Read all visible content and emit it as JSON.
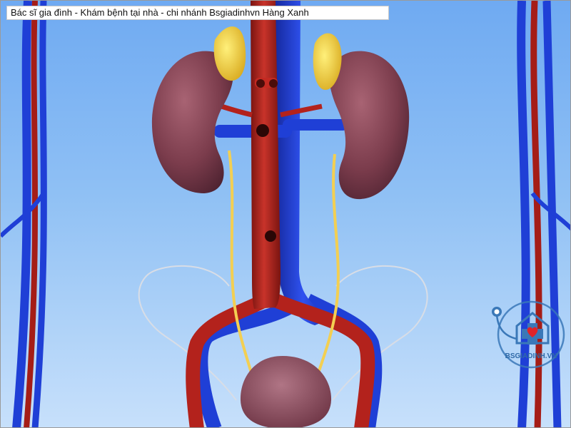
{
  "caption": {
    "text": "Bác sĩ gia đình - Khám bệnh tại nhà - chi nhánh Bsgiadinhvn Hàng Xanh"
  },
  "logo": {
    "text": "BSGIADINH.VN",
    "icons": [
      "house-icon",
      "medical-cross-icon",
      "heart-icon",
      "stethoscope-icon"
    ]
  },
  "colors": {
    "artery": "#b3221c",
    "vein": "#1f3fd6",
    "kidney": "#7e3f4e",
    "adrenal": "#f2d33a",
    "ureter": "#f3cf52",
    "bladder": "#8e4e5c",
    "background": "#8fc0f4",
    "logo": "#3a78b8",
    "logo_heart": "#e0242a"
  },
  "subject": "urinary-system-anatomy"
}
